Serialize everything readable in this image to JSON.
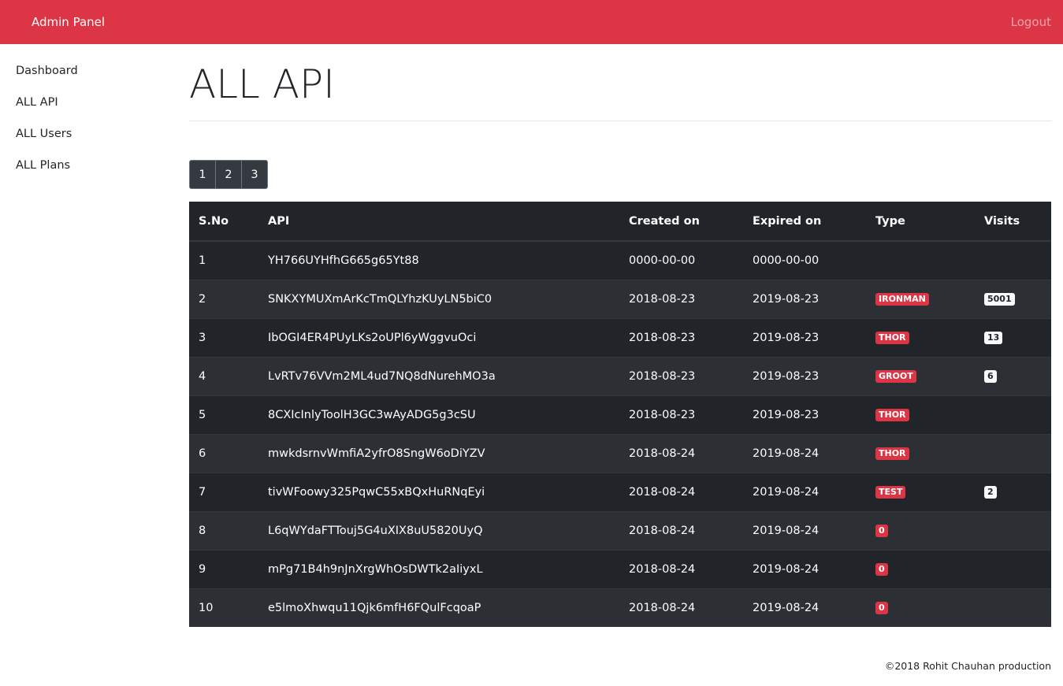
{
  "nav": {
    "brand": "Admin Panel",
    "logout": "Logout"
  },
  "sidebar": {
    "items": [
      {
        "label": "Dashboard"
      },
      {
        "label": "ALL API"
      },
      {
        "label": "ALL Users"
      },
      {
        "label": "ALL Plans"
      }
    ]
  },
  "page_title": "ALL API",
  "pagination": [
    "1",
    "2",
    "3"
  ],
  "table": {
    "headers": [
      "S.No",
      "API",
      "Created on",
      "Expired on",
      "Type",
      "Visits"
    ],
    "rows": [
      [
        "1",
        "YH766UYHfhG665g65Yt88",
        "0000-00-00",
        "0000-00-00",
        "",
        ""
      ],
      [
        "2",
        "SNKXYMUXmArKcTmQLYhzKUyLN5biC0",
        "2018-08-23",
        "2019-08-23",
        "IRONMAN",
        "5001"
      ],
      [
        "3",
        "IbOGI4ER4PUyLKs2oUPl6yWggvuOci",
        "2018-08-23",
        "2019-08-23",
        "THOR",
        "13"
      ],
      [
        "4",
        "LvRTv76VVm2ML4ud7NQ8dNurehMO3a",
        "2018-08-23",
        "2019-08-23",
        "GROOT",
        "6"
      ],
      [
        "5",
        "8CXIcInlyToolH3GC3wAyADG5g3cSU",
        "2018-08-23",
        "2019-08-23",
        "THOR",
        ""
      ],
      [
        "6",
        "mwkdsrnvWmfiA2yfrO8SngW6oDiYZV",
        "2018-08-24",
        "2019-08-24",
        "THOR",
        ""
      ],
      [
        "7",
        "tivWFoowy325PqwC55xBQxHuRNqEyi",
        "2018-08-24",
        "2019-08-24",
        "TEST",
        "2"
      ],
      [
        "8",
        "L6qWYdaFTTouj5G4uXIX8uU5820UyQ",
        "2018-08-24",
        "2019-08-24",
        "0",
        ""
      ],
      [
        "9",
        "mPg71B4h9nJnXrgWhOsDWTk2aIiyxL",
        "2018-08-24",
        "2019-08-24",
        "0",
        ""
      ],
      [
        "10",
        "e5lmoXhwqu11Qjk6mfH6FQulFcqoaP",
        "2018-08-24",
        "2019-08-24",
        "0",
        ""
      ]
    ]
  },
  "footer": "©2018 Rohit Chauhan production",
  "colors": {
    "brand": "#dc3545",
    "table_dark": "#212529"
  }
}
